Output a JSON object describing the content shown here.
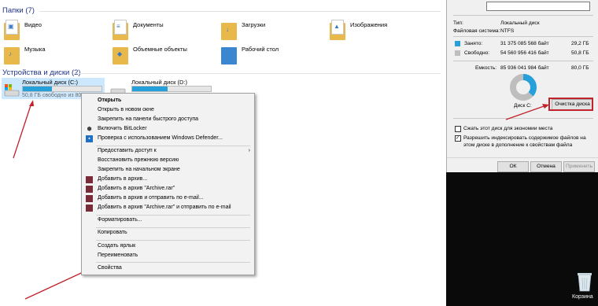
{
  "explorer": {
    "folders_header": "Папки (7)",
    "folders": [
      {
        "label": "Видео",
        "icon": "video-folder-icon"
      },
      {
        "label": "Документы",
        "icon": "documents-folder-icon"
      },
      {
        "label": "Загрузки",
        "icon": "downloads-folder-icon"
      },
      {
        "label": "Изображения",
        "icon": "pictures-folder-icon"
      },
      {
        "label": "Музыка",
        "icon": "music-folder-icon"
      },
      {
        "label": "Объемные объекты",
        "icon": "3d-objects-folder-icon"
      },
      {
        "label": "Рабочий стол",
        "icon": "desktop-folder-icon"
      }
    ],
    "devices_header": "Устройства и диски (2)",
    "drives": [
      {
        "label": "Локальный диск (C:)",
        "free": "50,8 ГБ свободно из 80,0 ГБ",
        "used_fraction": 0.37
      },
      {
        "label": "Локальный диск (D:)",
        "free": "",
        "used_fraction": 0.45
      }
    ]
  },
  "context_menu": {
    "items": [
      {
        "label": "Открыть",
        "bold": true
      },
      {
        "label": "Открыть в новом окне"
      },
      {
        "label": "Закрепить на панели быстрого доступа"
      },
      {
        "label": "Включить BitLocker",
        "icon": "shield-icon"
      },
      {
        "label": "Проверка с использованием Windows Defender...",
        "icon": "defender-icon"
      },
      {
        "label": "Предоставить доступ к",
        "submenu": true
      },
      {
        "label": "Восстановить прежнюю версию"
      },
      {
        "label": "Закрепить на начальном экране"
      },
      {
        "label": "Добавить в архив...",
        "icon": "winrar-icon"
      },
      {
        "label": "Добавить в архив \"Archive.rar\"",
        "icon": "winrar-icon"
      },
      {
        "label": "Добавить в архив и отправить по e-mail...",
        "icon": "winrar-icon"
      },
      {
        "label": "Добавить в архив \"Archive.rar\" и отправить по e-mail",
        "icon": "winrar-icon"
      },
      {
        "label": "Форматировать..."
      },
      {
        "label": "Копировать"
      },
      {
        "label": "Создать ярлык"
      },
      {
        "label": "Переименовать"
      },
      {
        "label": "Свойства"
      }
    ]
  },
  "properties": {
    "type_label": "Тип:",
    "type_value": "Локальный диск",
    "fs_label": "Файловая система:",
    "fs_value": "NTFS",
    "used_label": "Занято:",
    "used_bytes": "31 375 085 568 байт",
    "used_gb": "29,2 ГБ",
    "free_label": "Свободно:",
    "free_bytes": "54 560 956 416 байт",
    "free_gb": "50,8 ГБ",
    "capacity_label": "Емкость:",
    "capacity_bytes": "85 936 041 984 байт",
    "capacity_gb": "80,0 ГБ",
    "disk_label": "Диск C:",
    "cleanup_button": "Очистка диска",
    "compress_label": "Сжать этот диск для экономии места",
    "index_label": "Разрешить индексировать содержимое файлов на этом диске в дополнение к свойствам файла",
    "compress_checked": false,
    "index_checked": true,
    "ok": "ОК",
    "cancel": "Отмена",
    "apply": "Применить",
    "used_fraction": 0.365,
    "used_color": "#26a0da",
    "free_color": "#bebebe"
  },
  "desktop": {
    "recycle_bin_label": "Корзина"
  },
  "accent_color": "#c0232b"
}
